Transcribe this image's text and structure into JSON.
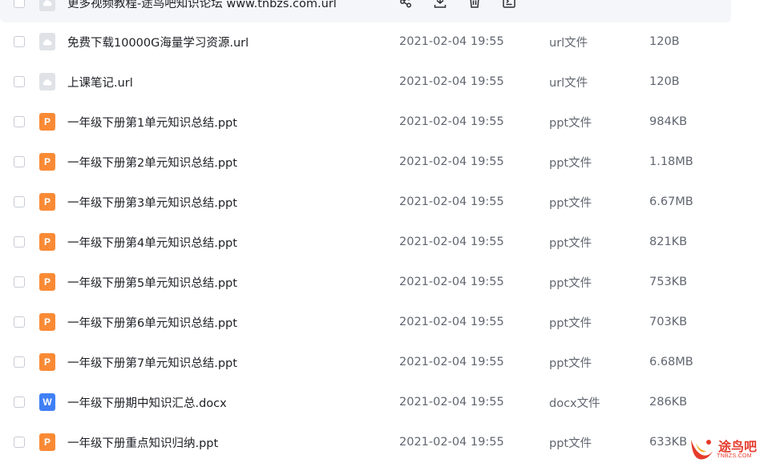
{
  "files": [
    {
      "name": "更多视频教程-途鸟吧知识论坛 www.tnbzs.com.url",
      "date": "",
      "type": "",
      "size": "",
      "icon": "url-file-icon",
      "hovered": true
    },
    {
      "name": "免费下载10000G海量学习资源.url",
      "date": "2021-02-04 19:55",
      "type": "url文件",
      "size": "120B",
      "icon": "url-file-icon"
    },
    {
      "name": "上课笔记.url",
      "date": "2021-02-04 19:55",
      "type": "url文件",
      "size": "120B",
      "icon": "url-file-icon"
    },
    {
      "name": "一年级下册第1单元知识总结.ppt",
      "date": "2021-02-04 19:55",
      "type": "ppt文件",
      "size": "984KB",
      "icon": "ppt-file-icon"
    },
    {
      "name": "一年级下册第2单元知识总结.ppt",
      "date": "2021-02-04 19:55",
      "type": "ppt文件",
      "size": "1.18MB",
      "icon": "ppt-file-icon"
    },
    {
      "name": "一年级下册第3单元知识总结.ppt",
      "date": "2021-02-04 19:55",
      "type": "ppt文件",
      "size": "6.67MB",
      "icon": "ppt-file-icon"
    },
    {
      "name": "一年级下册第4单元知识总结.ppt",
      "date": "2021-02-04 19:55",
      "type": "ppt文件",
      "size": "821KB",
      "icon": "ppt-file-icon"
    },
    {
      "name": "一年级下册第5单元知识总结.ppt",
      "date": "2021-02-04 19:55",
      "type": "ppt文件",
      "size": "753KB",
      "icon": "ppt-file-icon"
    },
    {
      "name": "一年级下册第6单元知识总结.ppt",
      "date": "2021-02-04 19:55",
      "type": "ppt文件",
      "size": "703KB",
      "icon": "ppt-file-icon"
    },
    {
      "name": "一年级下册第7单元知识总结.ppt",
      "date": "2021-02-04 19:55",
      "type": "ppt文件",
      "size": "6.68MB",
      "icon": "ppt-file-icon"
    },
    {
      "name": "一年级下册期中知识汇总.docx",
      "date": "2021-02-04 19:55",
      "type": "docx文件",
      "size": "286KB",
      "icon": "word-file-icon"
    },
    {
      "name": "一年级下册重点知识归纳.ppt",
      "date": "2021-02-04 19:55",
      "type": "ppt文件",
      "size": "633KB",
      "icon": "ppt-file-icon"
    }
  ],
  "icon_letters": {
    "ppt": "P",
    "word": "W"
  },
  "row_actions": [
    "share-icon",
    "download-icon",
    "delete-icon",
    "more-icon"
  ],
  "watermark": {
    "name": "途鸟吧",
    "url": "TNBZS.COM"
  },
  "colors": {
    "ppt": "#fa8a35",
    "word": "#3f7ff6",
    "url": "#dfe2e7",
    "watermark": "#e53b2c"
  }
}
